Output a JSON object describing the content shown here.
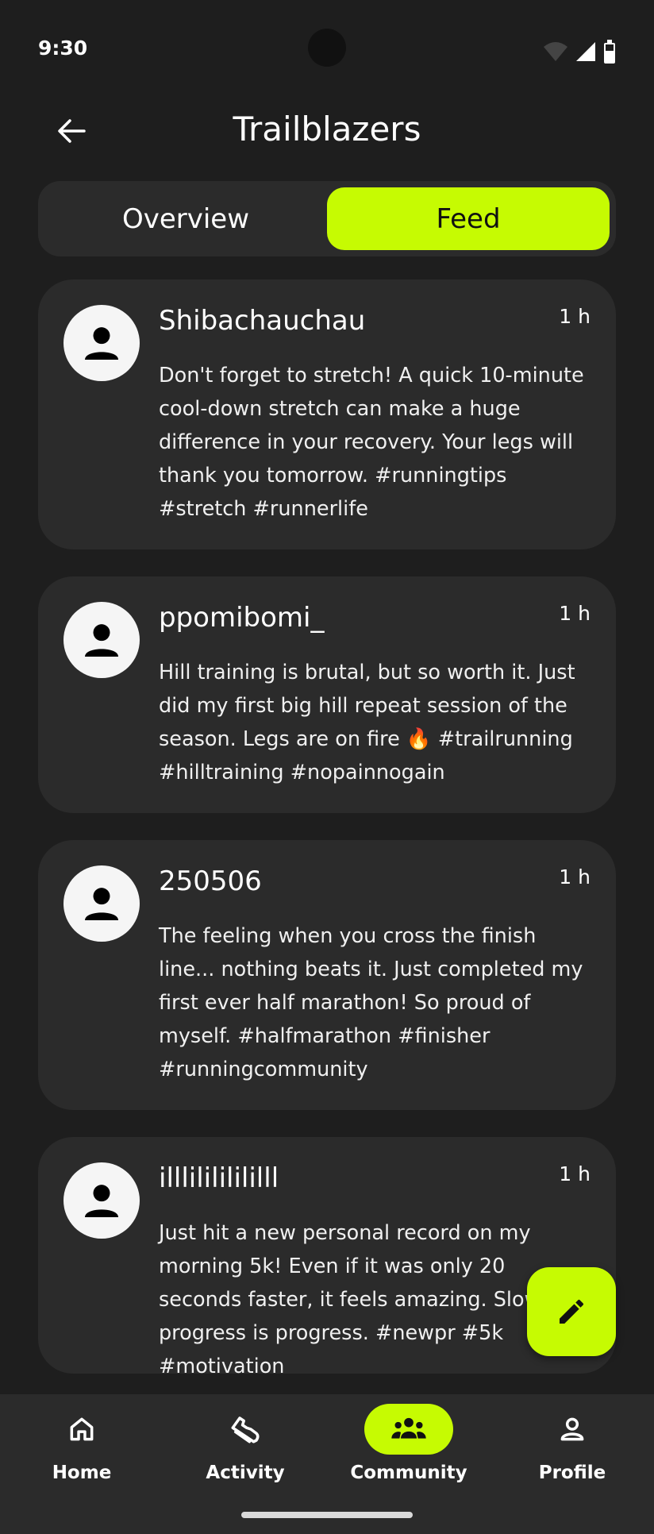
{
  "status_bar": {
    "time": "9:30"
  },
  "app_bar": {
    "title": "Trailblazers",
    "back_icon": "arrow-left-icon"
  },
  "tabs": [
    {
      "label": "Overview",
      "selected": false
    },
    {
      "label": "Feed",
      "selected": true
    }
  ],
  "posts": [
    {
      "user": "Shibachauchau",
      "time": "1 h",
      "body": "Don't forget to stretch! A quick 10-minute cool-down stretch can make a huge difference in your recovery. Your legs will thank you tomorrow. #runningtips #stretch #runnerlife"
    },
    {
      "user": "ppomibomi_",
      "time": "1 h",
      "body": "Hill training is brutal, but so worth it. Just did my first big hill repeat session of the season. Legs are on fire 🔥 #trailrunning #hilltraining #nopainnogain"
    },
    {
      "user": "250506",
      "time": "1 h",
      "body": "The feeling when you cross the finish line... nothing beats it. Just completed my first ever half marathon! So proud of myself. #halfmarathon #finisher #runningcommunity"
    },
    {
      "user": "illlilililililll",
      "time": "1 h",
      "body": "Just hit a new personal record on my morning 5k! Even if it was only 20 seconds faster, it feels amazing. Slow progress is progress. #newpr #5k #motivation"
    }
  ],
  "fab": {
    "icon": "pencil-icon"
  },
  "bottom_nav": [
    {
      "label": "Home",
      "icon": "home-icon",
      "active": false
    },
    {
      "label": "Activity",
      "icon": "shoe-icon",
      "active": false
    },
    {
      "label": "Community",
      "icon": "group-icon",
      "active": true
    },
    {
      "label": "Profile",
      "icon": "person-icon",
      "active": false
    }
  ],
  "colors": {
    "accent": "#c6fb02",
    "background": "#1e1e1e",
    "surface": "#2b2b2b"
  }
}
